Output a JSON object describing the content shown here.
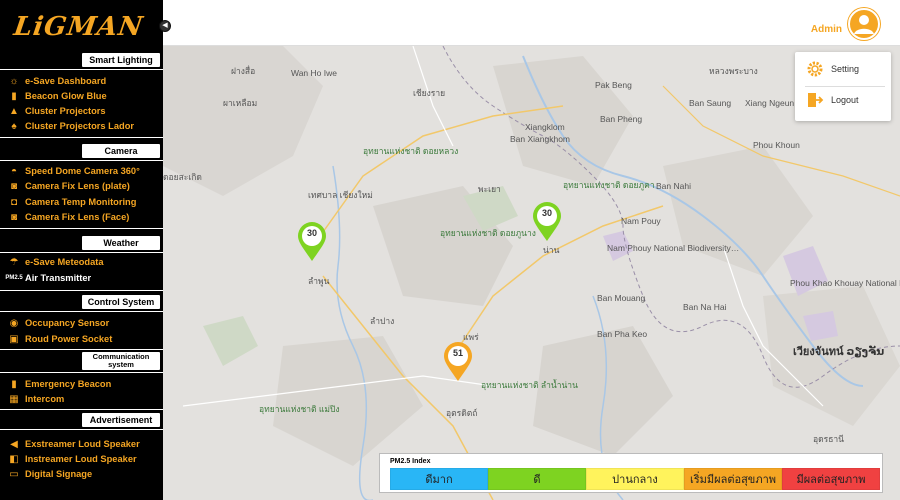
{
  "app": {
    "logo_text": "LiGMAN"
  },
  "header": {
    "admin_label": "Admin"
  },
  "user_menu": {
    "setting": "Setting",
    "logout": "Logout"
  },
  "sidebar": {
    "sections": {
      "smart_lighting": "Smart Lighting",
      "camera": "Camera",
      "weather": "Weather",
      "control_system": "Control System",
      "communication_system": "Communication system",
      "advertisement": "Advertisement"
    },
    "items": {
      "esave_dashboard": "e-Save Dashboard",
      "beacon_glow_blue": "Beacon Glow Blue",
      "cluster_projectors": "Cluster Projectors",
      "cluster_projectors_lador": "Cluster Projectors Lador",
      "speed_dome": "Speed Dome Camera 360°",
      "camera_fix_plate": "Camera Fix Lens (plate)",
      "camera_temp": "Camera Temp Monitoring",
      "camera_fix_face": "Camera Fix Lens (Face)",
      "esave_meteodata": "e-Save Meteodata",
      "air_transmitter": "Air Transmitter",
      "pm25_icon_text": "PM2.5",
      "occupancy_sensor": "Occupancy Sensor",
      "roud_power_socket": "Roud Power Socket",
      "emergency_beacon": "Emergency Beacon",
      "intercom": "Intercom",
      "exstreamer": "Exstreamer Loud Speaker",
      "instreamer": "Instreamer Loud Speaker",
      "digital_signage": "Digital Signage"
    }
  },
  "map": {
    "pins": [
      {
        "value": "30",
        "color": "#7ed321"
      },
      {
        "value": "30",
        "color": "#7ed321"
      },
      {
        "value": "51",
        "color": "#f5a623"
      }
    ],
    "labels": [
      "ฝางสื่อ",
      "Wan Ho Iwe",
      "ผาเหลือม",
      "เชียงราย",
      "Pak Beng",
      "หลวงพระบาง",
      "Ban Saung",
      "Xiang Ngeun",
      "Xiangklom",
      "Ban Pheng",
      "Ban Xiangkhom",
      "Phou Khoun",
      "อุทยานแห่งชาติ ดอยหลวง",
      "พะเยา",
      "อุทยานแห่งชาติ ดอยภูคา",
      "Ban Nahi",
      "น่าน",
      "Nam Pouy",
      "Nam Phouy National Biodiversity…",
      "Ban Mouang",
      "อุทยานแห่งชาติ ดอยภูนาง",
      "ลำพูน",
      "ลำปาง",
      "แพร่",
      "Ban Pha Keo",
      "Ban Na Hai",
      "อุทยานแห่งชาติ แม่ปิง",
      "อุตรดิตถ์",
      "อุทยานแห่งชาติ ลำน้ำน่าน",
      "Phou Khao Khouay National Bio",
      "เวียงจันทน์ ວຽງຈັນ",
      "อุดรธานี",
      "เทศบาล เชียงใหม่",
      "ดอยสะเกิด"
    ]
  },
  "legend": {
    "title": "PM2.5 Index",
    "levels": [
      {
        "label": "ดีมาก",
        "color": "#29b6f6"
      },
      {
        "label": "ดี",
        "color": "#7ed321"
      },
      {
        "label": "ปานกลาง",
        "color": "#fff35c"
      },
      {
        "label": "เริ่มมีผลต่อสุขภาพ",
        "color": "#f5a623"
      },
      {
        "label": "มีผลต่อสุขภาพ",
        "color": "#f04141"
      }
    ]
  }
}
